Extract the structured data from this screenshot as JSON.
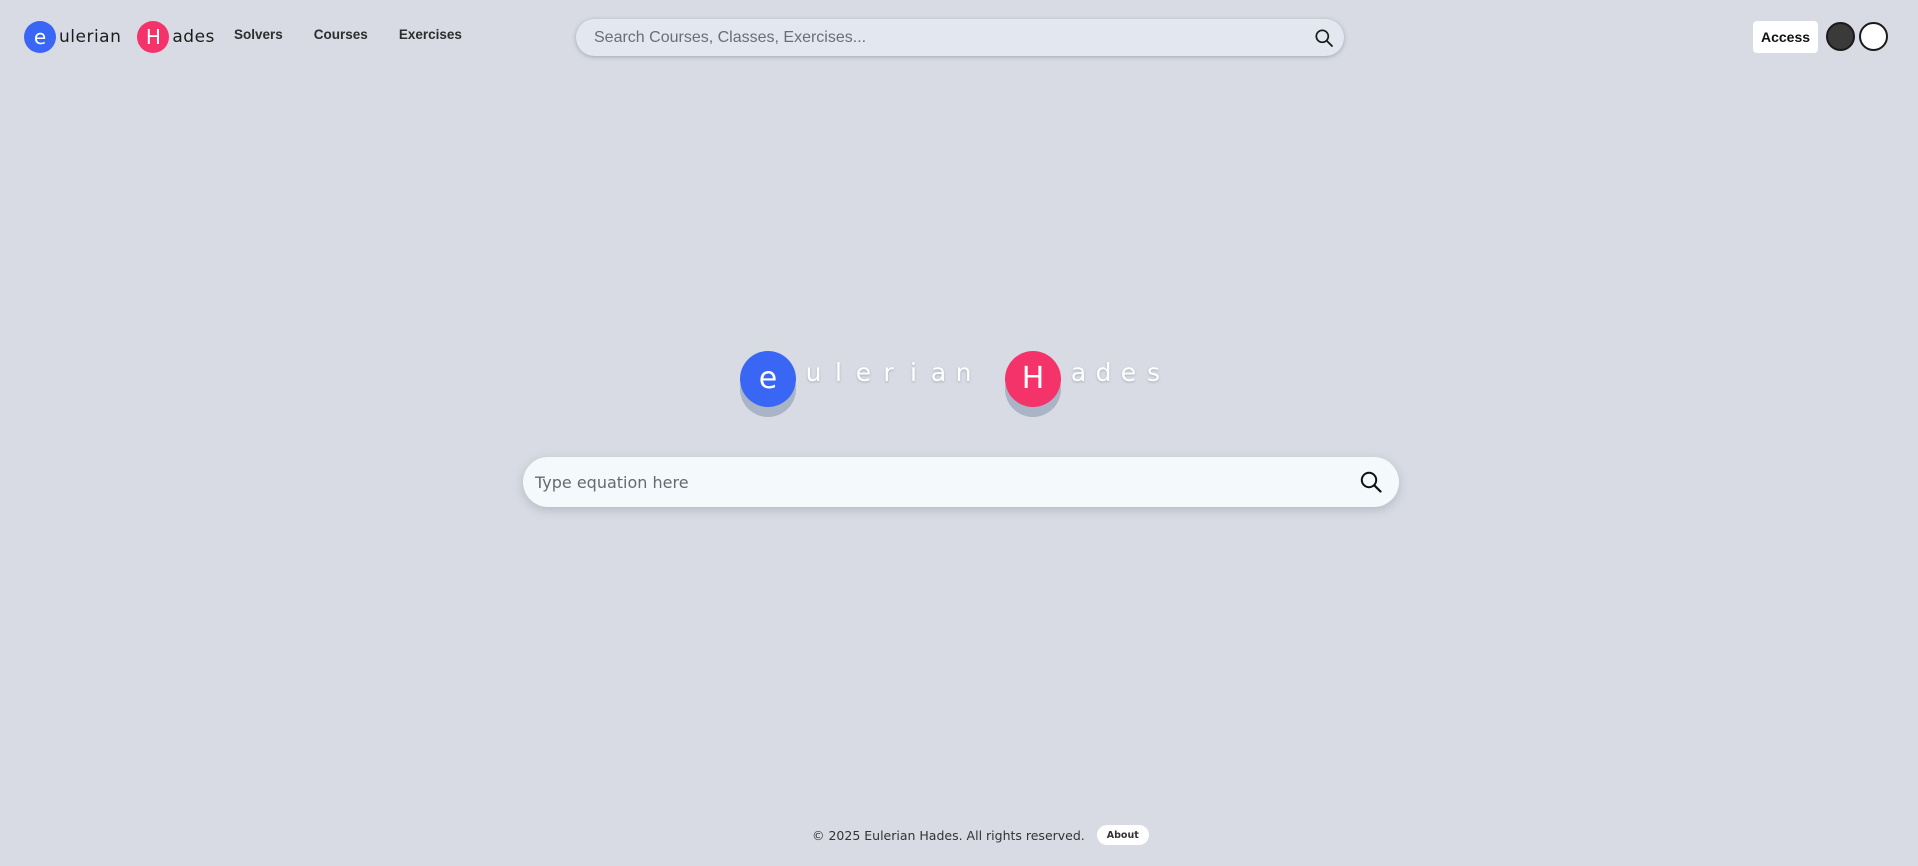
{
  "brand": {
    "first_initial": "e",
    "first_rest": "ulerian",
    "second_initial": "H",
    "second_rest": "ades"
  },
  "nav": {
    "items": [
      {
        "label": "Solvers"
      },
      {
        "label": "Courses"
      },
      {
        "label": "Exercises"
      }
    ]
  },
  "top_search": {
    "placeholder": "Search Courses, Classes, Exercises...",
    "icon": "search-icon"
  },
  "header_actions": {
    "access_label": "Access",
    "theme_options": [
      "dark",
      "light"
    ]
  },
  "hero": {
    "first_initial": "e",
    "first_letters": [
      "u",
      "l",
      "e",
      "r",
      "i",
      "a",
      "n"
    ],
    "second_initial": "H",
    "second_letters": [
      "a",
      "d",
      "e",
      "s"
    ]
  },
  "equation_search": {
    "placeholder": "Type equation here",
    "icon": "search-icon"
  },
  "footer": {
    "copyright": "© 2025 Eulerian Hades. All rights reserved.",
    "about_label": "About"
  },
  "colors": {
    "background": "#d8dbe3",
    "brand_blue": "#3a66f5",
    "brand_pink": "#f4336a"
  }
}
